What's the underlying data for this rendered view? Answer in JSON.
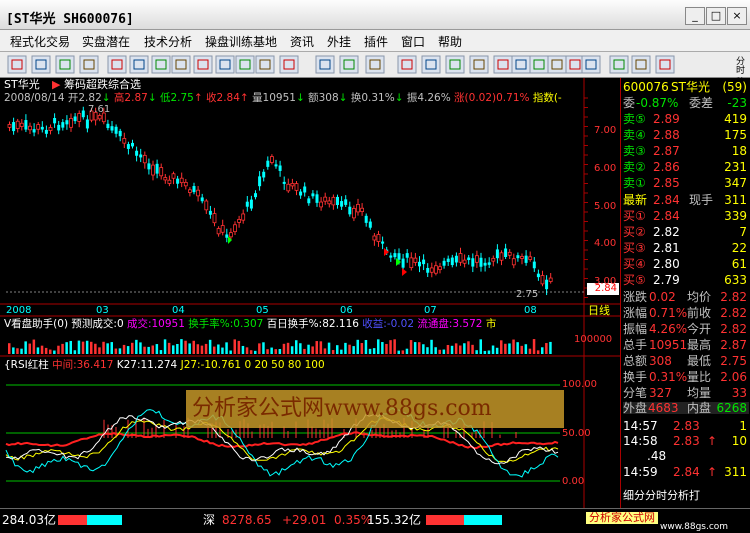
{
  "window": {
    "title": "[ST华光 SH600076]",
    "btn_min": "_",
    "btn_max": "□",
    "btn_close": "×"
  },
  "menu": [
    "程式化交易",
    "实盘潜在",
    "技术分析",
    "操盘训练基地",
    "资讯",
    "外挂",
    "插件",
    "窗口",
    "帮助"
  ],
  "side_label": "分时 移动",
  "header": {
    "name": "ST华光",
    "indicator": "筹码超跌综合选",
    "date": "2008/08/14",
    "open": "开2.82",
    "high": "高2.87",
    "low": "低2.75",
    "close": "收2.84",
    "vol": "量10951",
    "amt": "额308",
    "turn": "换0.31%",
    "amp": "振4.26%",
    "chg": "涨(0.02)0.71%",
    "idx": "指数(-"
  },
  "price_axis": [
    "7.00",
    "6.00",
    "5.00",
    "4.00",
    "3.00"
  ],
  "annot_max": "7.61",
  "annot_min": "2.75",
  "price_tag": "2.84",
  "months": [
    "2008",
    "03",
    "04",
    "05",
    "06",
    "07",
    "08"
  ],
  "period": "日线",
  "vol_header": {
    "a": "V看盘助手(0)",
    "b": "预测成交:0",
    "c": "成交:10951",
    "d": "换手率%:0.307",
    "e": "百日换手%:82.116",
    "f": "收益:-0.02",
    "g": "流通盘:3.572",
    "h": "市"
  },
  "vol_axis": [
    "100000"
  ],
  "rsi_header": {
    "a": "{RSI红柱",
    "b": "中间:36.417",
    "c": "K27:11.274",
    "d": "J27:-10.761",
    "e": "0 20 50 80 100"
  },
  "rsi_axis": [
    "100.00",
    "50.00",
    "0.00"
  ],
  "watermark": "分析家公式网www.88gs.com",
  "quote": {
    "code": "600076",
    "name": "ST华光",
    "num": "(59)",
    "ratio_l": "委",
    "ratio_v": "-0.87%",
    "diff_l": "委差",
    "diff_v": "-23",
    "asks": [
      {
        "l": "卖⑤",
        "p": "2.89",
        "v": "419"
      },
      {
        "l": "卖④",
        "p": "2.88",
        "v": "175"
      },
      {
        "l": "卖③",
        "p": "2.87",
        "v": "18"
      },
      {
        "l": "卖②",
        "p": "2.86",
        "v": "231"
      },
      {
        "l": "卖①",
        "p": "2.85",
        "v": "347"
      }
    ],
    "last_l": "最新",
    "last_v": "2.84",
    "now_l": "现手",
    "now_v": "311",
    "bids": [
      {
        "l": "买①",
        "p": "2.84",
        "v": "339"
      },
      {
        "l": "买②",
        "p": "2.82",
        "v": "7"
      },
      {
        "l": "买③",
        "p": "2.81",
        "v": "22"
      },
      {
        "l": "买④",
        "p": "2.80",
        "v": "61"
      },
      {
        "l": "买⑤",
        "p": "2.79",
        "v": "633"
      }
    ],
    "stats": [
      [
        "涨跌",
        "0.02",
        "均价",
        "2.82"
      ],
      [
        "涨幅",
        "0.71%",
        "前收",
        "2.82"
      ],
      [
        "振幅",
        "4.26%",
        "今开",
        "2.82"
      ],
      [
        "总手",
        "10951",
        "最高",
        "2.87"
      ],
      [
        "总额",
        "308",
        "最低",
        "2.75"
      ],
      [
        "换手",
        "0.31%",
        "量比",
        "2.06"
      ],
      [
        "分笔",
        "327",
        "均量",
        "33"
      ]
    ],
    "outer_l": "外盘",
    "outer_v": "4683",
    "inner_l": "内盘",
    "inner_v": "6268",
    "ticks": [
      [
        "14:57",
        "2.83",
        "1"
      ],
      [
        "14:58",
        "2.83",
        "10"
      ],
      [
        "14:59",
        "2.84",
        "311"
      ]
    ],
    "ticks_sell": "↑",
    "ticks_dot": ".48",
    "foot": "细分分时分析打"
  },
  "status": {
    "left": "284.03亿",
    "sz_l": "深",
    "sz_v": "8278.65",
    "sz_c": "+29.01",
    "sz_p": "0.35%",
    "sz_a": "155.32亿",
    "right": "分析家公式网",
    "url": "www.88gs.com"
  }
}
